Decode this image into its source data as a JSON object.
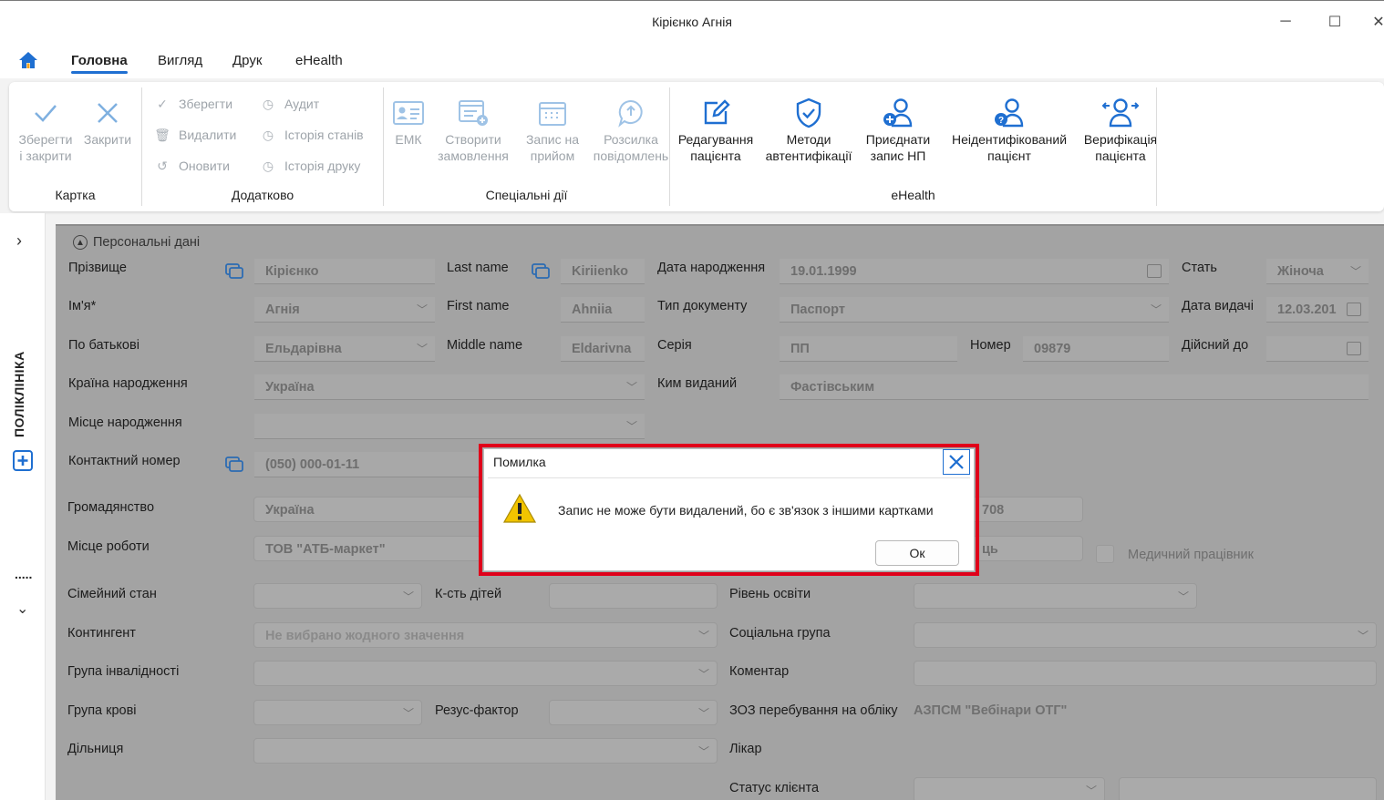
{
  "window": {
    "title": "Кірієнко Агнія",
    "minimize": "─",
    "maximize": "☐",
    "close": "✕"
  },
  "menu": {
    "tabs": [
      "Головна",
      "Вигляд",
      "Друк",
      "eHealth"
    ],
    "active": "Головна"
  },
  "ribbon": {
    "karta": {
      "label": "Картка",
      "save_close": [
        "Зберегти",
        "і закрити"
      ],
      "close": "Закрити"
    },
    "dodatkovo": {
      "label": "Додатково",
      "save": "Зберегти",
      "delete": "Видалити",
      "refresh": "Оновити",
      "audit": "Аудит",
      "state_history": "Історія станів",
      "print_history": "Історія друку"
    },
    "special": {
      "label": "Спеціальні дії",
      "emk": "ЕМК",
      "create_order": [
        "Створити",
        "замовлення"
      ],
      "appointment": [
        "Запис на",
        "прийом"
      ],
      "mailing": [
        "Розсилка",
        "повідомлень"
      ]
    },
    "ehealth": {
      "label": "eHealth",
      "edit_patient": [
        "Редагування",
        "пацієнта"
      ],
      "auth_methods": [
        "Методи",
        "автентифікації"
      ],
      "attach_np": [
        "Приєднати",
        "запис НП"
      ],
      "unidentified": [
        "Неідентифікований",
        "пацієнт"
      ],
      "verify": [
        "Верифікація",
        "пацієнта"
      ]
    }
  },
  "sidebar": {
    "label": "ПОЛІКЛІНІКА",
    "dots": "....."
  },
  "form": {
    "section": "Персональні дані",
    "surname_label": "Прізвище",
    "surname": "Кірієнко",
    "lastname_label": "Last name",
    "lastname": "Kiriienko",
    "dob_label": "Дата народження",
    "dob": "19.01.1999",
    "sex_label": "Стать",
    "sex": "Жіноча",
    "name_label": "Ім'я*",
    "name": "Агнія",
    "firstname_label": "First name",
    "firstname": "Ahniia",
    "doctype_label": "Тип документу",
    "doctype": "Паспорт",
    "issue_date_label": "Дата видачі",
    "issue_date": "12.03.201",
    "patronymic_label": "По батькові",
    "patronymic": "Ельдарівна",
    "middlename_label": "Middle name",
    "middlename": "Eldarivna",
    "series_label": "Серія",
    "series": "ПП",
    "number_label": "Номер",
    "number": "09879",
    "valid_until_label": "Дійсний до",
    "birth_country_label": "Країна народження",
    "birth_country": "Україна",
    "issued_by_label": "Ким виданий",
    "issued_by": "Фастівським",
    "birth_place_label": "Місце народження",
    "phone_label": "Контактний номер",
    "phone": "(050) 000-01-11",
    "citizenship_label": "Громадянство",
    "citizenship": "Україна",
    "partial_708": "708",
    "work_label": "Місце роботи",
    "work": "ТОВ \"АТБ-маркет\"",
    "partial_ts": "ць",
    "med_worker_label": "Медичний працівник",
    "marital_label": "Сімейний стан",
    "children_label": "К-сть дітей",
    "education_label": "Рівень освіти",
    "contingent_label": "Контингент",
    "contingent": "Не вибрано жодного значення",
    "social_label": "Соціальна група",
    "disability_label": "Група інвалідності",
    "comment_label": "Коментар",
    "blood_label": "Група крові",
    "rhesus_label": "Резус-фактор",
    "zoz_label": "ЗОЗ перебування на обліку",
    "zoz": "АЗПСМ \"Вебінари ОТГ\"",
    "district_label": "Дільниця",
    "doctor_label": "Лікар",
    "client_status_label": "Статус клієнта"
  },
  "dialog": {
    "title": "Помилка",
    "message": "Запис не може бути видалений, бо є зв'язок з іншими картками",
    "ok": "Ок"
  },
  "colors": {
    "accent": "#1f6fd1",
    "highlight": "#e0001a",
    "warning": "#f2c400"
  }
}
